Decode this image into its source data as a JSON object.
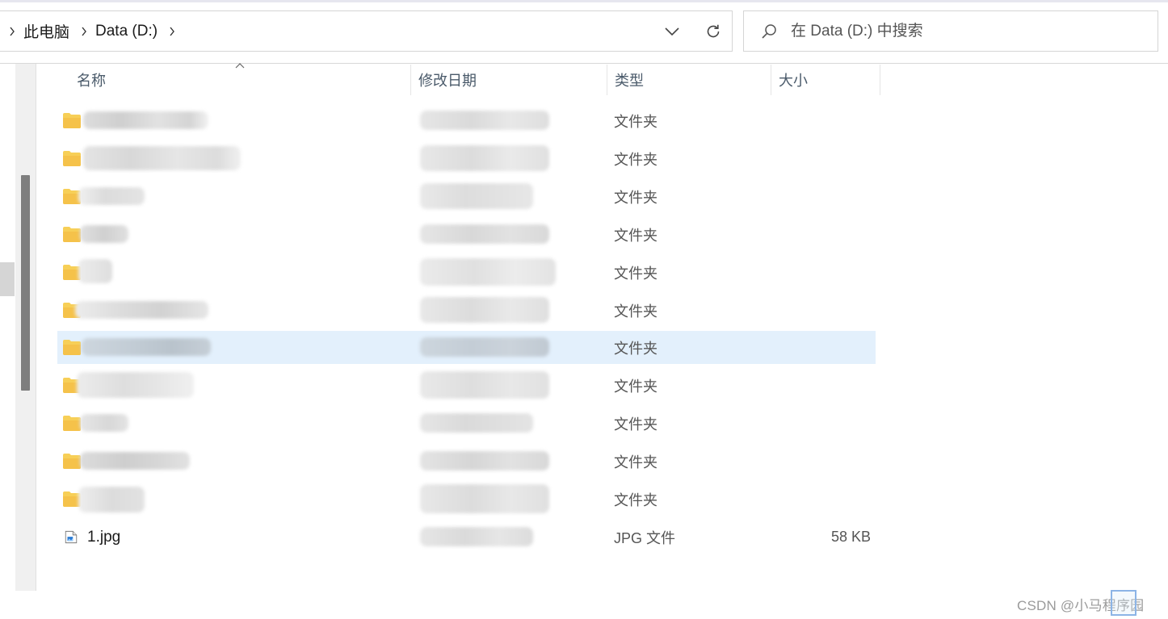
{
  "breadcrumb": {
    "items": [
      "此电脑",
      "Data (D:)"
    ]
  },
  "search": {
    "placeholder": "在 Data (D:) 中搜索"
  },
  "columns": {
    "name": "名称",
    "modified": "修改日期",
    "type": "类型",
    "size": "大小"
  },
  "files": [
    {
      "kind": "folder",
      "type": "文件夹"
    },
    {
      "kind": "folder",
      "type": "文件夹"
    },
    {
      "kind": "folder",
      "type": "文件夹"
    },
    {
      "kind": "folder",
      "type": "文件夹"
    },
    {
      "kind": "folder",
      "type": "文件夹"
    },
    {
      "kind": "folder",
      "type": "文件夹"
    },
    {
      "kind": "folder",
      "type": "文件夹",
      "selected": true
    },
    {
      "kind": "folder",
      "type": "文件夹"
    },
    {
      "kind": "folder",
      "type": "文件夹"
    },
    {
      "kind": "folder",
      "type": "文件夹"
    },
    {
      "kind": "folder",
      "type": "文件夹"
    },
    {
      "kind": "file",
      "name": "1.jpg",
      "type": "JPG 文件",
      "size": "58 KB"
    }
  ],
  "watermark": "CSDN @小马程序园",
  "colors": {
    "selection": "#e3f0fc",
    "folder": "#f5c84c",
    "header_text": "#4a5a6a"
  }
}
